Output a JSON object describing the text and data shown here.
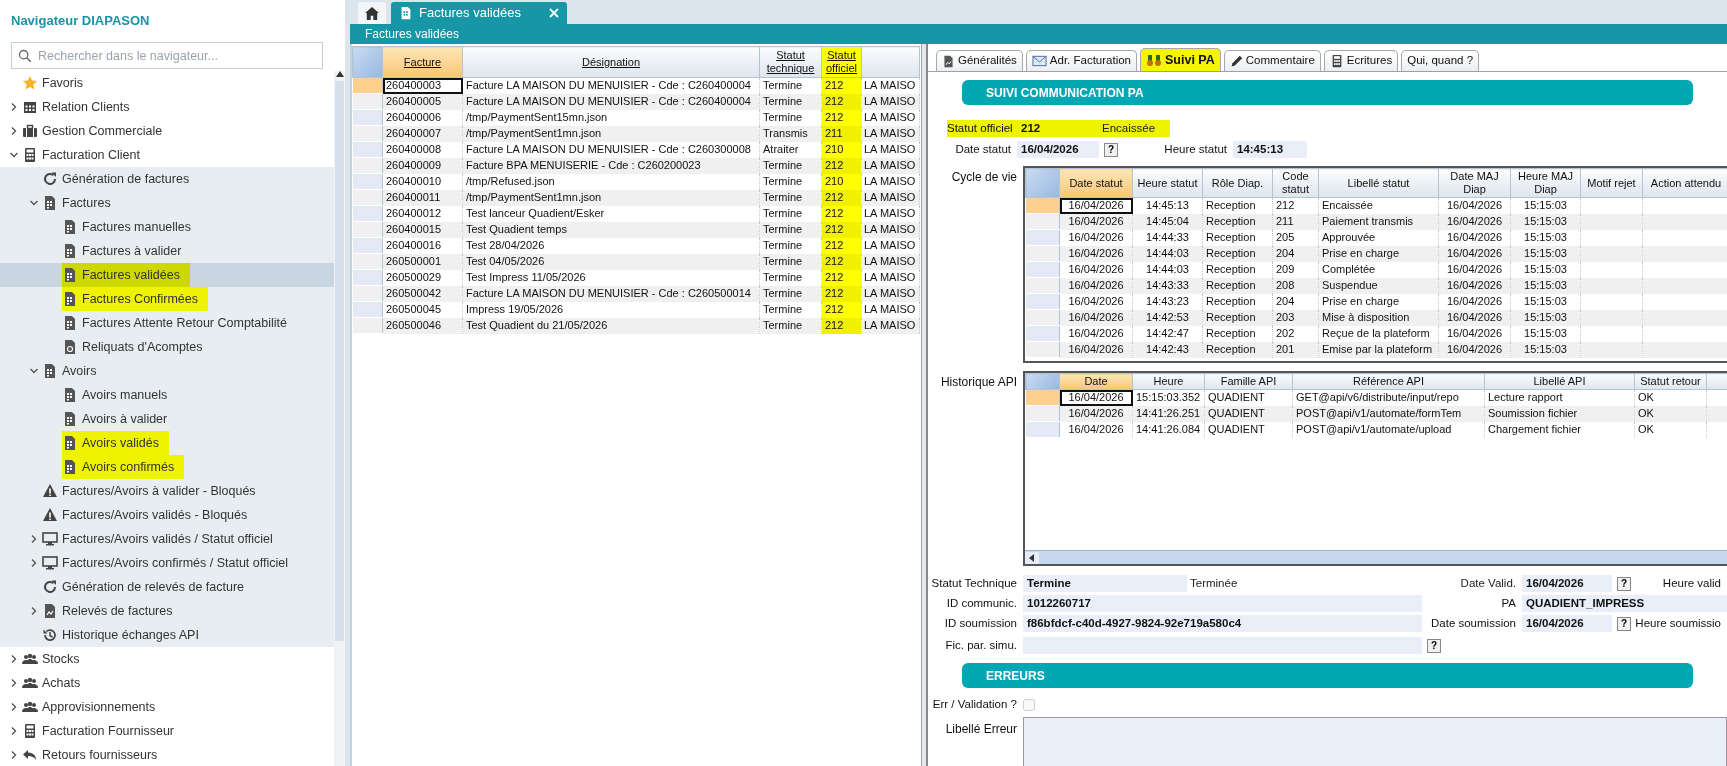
{
  "sidebar": {
    "title": "Navigateur DIAPASON",
    "search": {
      "placeholder": "Rechercher dans le navigateur..."
    },
    "items": [
      {
        "label": "Favoris",
        "selected": false,
        "highlighted": false
      },
      {
        "label": "Relation Clients",
        "selected": false,
        "highlighted": false,
        "expanded": false
      },
      {
        "label": "Gestion Commerciale",
        "selected": false,
        "highlighted": false,
        "expanded": false
      },
      {
        "label": "Facturation Client",
        "selected": false,
        "highlighted": false,
        "expanded": true,
        "children": [
          {
            "label": "Génération de factures",
            "selected": false,
            "highlighted": false
          },
          {
            "label": "Factures",
            "selected": false,
            "highlighted": false,
            "expanded": true,
            "children": [
              {
                "label": "Factures manuelles",
                "selected": false,
                "highlighted": false
              },
              {
                "label": "Factures à valider",
                "selected": false,
                "highlighted": false
              },
              {
                "label": "Factures validées",
                "selected": true,
                "highlighted": true
              },
              {
                "label": "Factures Confirmées",
                "selected": false,
                "highlighted": true
              },
              {
                "label": "Factures Attente Retour Comptabilité",
                "selected": false,
                "highlighted": false
              },
              {
                "label": "Reliquats d'Acomptes",
                "selected": false,
                "highlighted": false
              }
            ]
          },
          {
            "label": "Avoirs",
            "selected": false,
            "highlighted": false,
            "expanded": true,
            "children": [
              {
                "label": "Avoirs manuels",
                "selected": false,
                "highlighted": false
              },
              {
                "label": "Avoirs à valider",
                "selected": false,
                "highlighted": false
              },
              {
                "label": "Avoirs validés",
                "selected": false,
                "highlighted": true
              },
              {
                "label": "Avoirs confirmés",
                "selected": false,
                "highlighted": true
              }
            ]
          },
          {
            "label": "Factures/Avoirs à valider - Bloqués",
            "selected": false,
            "highlighted": false
          },
          {
            "label": "Factures/Avoirs validés - Bloqués",
            "selected": false,
            "highlighted": false
          },
          {
            "label": "Factures/Avoirs validés / Statut officiel",
            "selected": false,
            "highlighted": false,
            "expanded": false
          },
          {
            "label": "Factures/Avoirs confirmés / Statut officiel",
            "selected": false,
            "highlighted": false,
            "expanded": false
          },
          {
            "label": "Génération de relevés de facture",
            "selected": false,
            "highlighted": false
          },
          {
            "label": "Relevés de factures",
            "selected": false,
            "highlighted": false,
            "expanded": false
          },
          {
            "label": "Historique échanges API",
            "selected": false,
            "highlighted": false
          }
        ]
      },
      {
        "label": "Stocks",
        "selected": false,
        "highlighted": false,
        "expanded": false
      },
      {
        "label": "Achats",
        "selected": false,
        "highlighted": false,
        "expanded": false
      },
      {
        "label": "Approvisionnements",
        "selected": false,
        "highlighted": false,
        "expanded": false
      },
      {
        "label": "Facturation Fournisseur",
        "selected": false,
        "highlighted": false,
        "expanded": false
      },
      {
        "label": "Retours fournisseurs",
        "selected": false,
        "highlighted": false,
        "expanded": false
      }
    ]
  },
  "tabs": [
    {
      "kind": "home",
      "selected": false
    },
    {
      "kind": "document",
      "label": "Factures validées",
      "selected": true
    }
  ],
  "list_panel": {
    "title": "Factures validées",
    "columns": [
      {
        "label": "Facture",
        "sorted": true,
        "highlighted": false
      },
      {
        "label": "Désignation",
        "sorted": false,
        "highlighted": false
      },
      {
        "label": "Statut technique",
        "sorted": false,
        "highlighted": false
      },
      {
        "label": "Statut officiel",
        "sorted": false,
        "highlighted": true
      },
      {
        "sorted": false,
        "highlighted": false
      }
    ],
    "rows": [
      {
        "selected": true,
        "cells": [
          "260400003",
          "Facture LA MAISON DU MENUISIER - Cde : C260400004",
          "Termine",
          "212",
          "LA MAISO"
        ]
      },
      {
        "selected": false,
        "cells": [
          "260400005",
          "Facture LA MAISON DU MENUISIER - Cde : C260400004",
          "Termine",
          "212",
          "LA MAISO"
        ]
      },
      {
        "selected": false,
        "cells": [
          "260400006",
          "/tmp/PaymentSent15mn.json",
          "Termine",
          "212",
          "LA MAISO"
        ]
      },
      {
        "selected": false,
        "cells": [
          "260400007",
          "/tmp/PaymentSent1mn.json",
          "Transmis",
          "211",
          "LA MAISO"
        ]
      },
      {
        "selected": false,
        "cells": [
          "260400008",
          "Facture LA MAISON DU MENUISIER - Cde : C260300008",
          "Atraiter",
          "210",
          "LA MAISO"
        ]
      },
      {
        "selected": false,
        "cells": [
          "260400009",
          "Facture BPA MENUISERIE - Cde : C260200023",
          "Termine",
          "212",
          "LA MAISO"
        ]
      },
      {
        "selected": false,
        "cells": [
          "260400010",
          "/tmp/Refused.json",
          "Termine",
          "210",
          "LA MAISO"
        ]
      },
      {
        "selected": false,
        "cells": [
          "260400011",
          "/tmp/PaymentSent1mn.json",
          "Termine",
          "212",
          "LA MAISO"
        ]
      },
      {
        "selected": false,
        "cells": [
          "260400012",
          "Test lanceur Quadient/Esker",
          "Termine",
          "212",
          "LA MAISO"
        ]
      },
      {
        "selected": false,
        "cells": [
          "260400015",
          "Test Quadient temps",
          "Termine",
          "212",
          "LA MAISO"
        ]
      },
      {
        "selected": false,
        "cells": [
          "260400016",
          "Test 28/04/2026",
          "Termine",
          "212",
          "LA MAISO"
        ]
      },
      {
        "selected": false,
        "cells": [
          "260500001",
          "Test 04/05/2026",
          "Termine",
          "212",
          "LA MAISO"
        ]
      },
      {
        "selected": false,
        "cells": [
          "260500029",
          "Test Impress 11/05/2026",
          "Termine",
          "212",
          "LA MAISO"
        ]
      },
      {
        "selected": false,
        "cells": [
          "260500042",
          "Facture LA MAISON DU MENUISIER - Cde : C260500014",
          "Termine",
          "212",
          "LA MAISO"
        ]
      },
      {
        "selected": false,
        "cells": [
          "260500045",
          "Impress 19/05/2026",
          "Termine",
          "212",
          "LA MAISO"
        ]
      },
      {
        "selected": false,
        "cells": [
          "260500046",
          "Test Quadient du 21/05/2026",
          "Termine",
          "212",
          "LA MAISO"
        ]
      }
    ]
  },
  "detail": {
    "tabs": [
      {
        "label": "Généralités",
        "selected": false,
        "highlighted": false
      },
      {
        "label": "Adr. Facturation",
        "selected": false,
        "highlighted": false
      },
      {
        "label": "Suivi PA",
        "selected": true,
        "highlighted": true
      },
      {
        "label": "Commentaire",
        "selected": false,
        "highlighted": false
      },
      {
        "label": "Ecritures",
        "selected": false,
        "highlighted": false
      },
      {
        "label": "Qui, quand ?",
        "selected": false,
        "highlighted": false
      }
    ],
    "section_title": "SUIVI COMMUNICATION PA",
    "statut_officiel": {
      "label": "Statut officiel",
      "code": "212",
      "libelle": "Encaissée",
      "highlighted": true
    },
    "date_statut": {
      "label": "Date statut",
      "value": "16/04/2026",
      "help": "?"
    },
    "heure_statut": {
      "label": "Heure statut",
      "value": "14:45:13"
    },
    "cycle_de_vie": {
      "label": "Cycle de vie",
      "columns": [
        {
          "label": "Date statut",
          "sorted": true
        },
        {
          "label": "Heure statut",
          "sorted": false
        },
        {
          "label": "Rôle Diap.",
          "sorted": false
        },
        {
          "label": "Code statut",
          "sorted": false
        },
        {
          "label": "Libellé statut",
          "sorted": false
        },
        {
          "label": "Date MAJ Diap",
          "sorted": false
        },
        {
          "label": "Heure MAJ Diap",
          "sorted": false
        },
        {
          "label": "Motif rejet",
          "sorted": false
        },
        {
          "label": "Action attendu",
          "sorted": false
        }
      ],
      "rows": [
        {
          "selected": true,
          "cells": [
            "16/04/2026",
            "14:45:13",
            "Reception",
            "212",
            "Encaissée",
            "16/04/2026",
            "15:15:03"
          ]
        },
        {
          "selected": false,
          "cells": [
            "16/04/2026",
            "14:45:04",
            "Reception",
            "211",
            "Paiement transmis",
            "16/04/2026",
            "15:15:03"
          ]
        },
        {
          "selected": false,
          "cells": [
            "16/04/2026",
            "14:44:33",
            "Reception",
            "205",
            "Approuvée",
            "16/04/2026",
            "15:15:03"
          ]
        },
        {
          "selected": false,
          "cells": [
            "16/04/2026",
            "14:44:03",
            "Reception",
            "204",
            "Prise en charge",
            "16/04/2026",
            "15:15:03"
          ]
        },
        {
          "selected": false,
          "cells": [
            "16/04/2026",
            "14:44:03",
            "Reception",
            "209",
            "Complétée",
            "16/04/2026",
            "15:15:03"
          ]
        },
        {
          "selected": false,
          "cells": [
            "16/04/2026",
            "14:43:33",
            "Reception",
            "208",
            "Suspendue",
            "16/04/2026",
            "15:15:03"
          ]
        },
        {
          "selected": false,
          "cells": [
            "16/04/2026",
            "14:43:23",
            "Reception",
            "204",
            "Prise en charge",
            "16/04/2026",
            "15:15:03"
          ]
        },
        {
          "selected": false,
          "cells": [
            "16/04/2026",
            "14:42:53",
            "Reception",
            "203",
            "Mise à disposition",
            "16/04/2026",
            "15:15:03"
          ]
        },
        {
          "selected": false,
          "cells": [
            "16/04/2026",
            "14:42:47",
            "Reception",
            "202",
            "Reçue de la plateform",
            "16/04/2026",
            "15:15:03"
          ]
        },
        {
          "selected": false,
          "cells": [
            "16/04/2026",
            "14:42:43",
            "Reception",
            "201",
            "Emise par la plateform",
            "16/04/2026",
            "15:15:03"
          ]
        }
      ]
    },
    "historique_api": {
      "label": "Historique API",
      "columns": [
        {
          "label": "Date",
          "sorted": true
        },
        {
          "label": "Heure",
          "sorted": false
        },
        {
          "label": "Famille API",
          "sorted": false
        },
        {
          "label": "Référence API",
          "sorted": false
        },
        {
          "label": "Libellé API",
          "sorted": false
        },
        {
          "label": "Statut retour",
          "sorted": false
        },
        {
          "sorted": false
        }
      ],
      "rows": [
        {
          "selected": true,
          "cells": [
            "16/04/2026",
            "15:15:03.352",
            "QUADIENT",
            "GET@api/v6/distribute/input/repo",
            "Lecture rapport",
            "OK"
          ]
        },
        {
          "selected": false,
          "cells": [
            "16/04/2026",
            "14:41:26.251",
            "QUADIENT",
            "POST@api/v1/automate/formTem",
            "Soumission fichier",
            "OK"
          ]
        },
        {
          "selected": false,
          "cells": [
            "16/04/2026",
            "14:41:26.084",
            "QUADIENT",
            "POST@api/v1/automate/upload",
            "Chargement fichier",
            "OK"
          ]
        }
      ]
    },
    "statut_technique": {
      "label": "Statut Technique",
      "value": "Termine",
      "libelle": "Terminée"
    },
    "date_valid": {
      "label": "Date Valid.",
      "value": "16/04/2026",
      "help": "?"
    },
    "heure_valid": {
      "label": "Heure valid"
    },
    "id_communic": {
      "label": "ID communic.",
      "value": "1012260717"
    },
    "pa": {
      "label": "PA",
      "value": "QUADIENT_IMPRESS"
    },
    "id_soumission": {
      "label": "ID soumission",
      "value": "f86bfdcf-c40d-4927-9824-92e719a580c4"
    },
    "date_soumission": {
      "label": "Date soumission",
      "value": "16/04/2026",
      "help": "?"
    },
    "heure_soumission": {
      "label": "Heure soumissio"
    },
    "fic_par_simu": {
      "label": "Fic. par. simu.",
      "help": "?"
    },
    "errors_title": "ERREURS",
    "err_validation": {
      "label": "Err / Validation ?",
      "checked": false
    },
    "libelle_erreur": {
      "label": "Libellé Erreur"
    }
  }
}
